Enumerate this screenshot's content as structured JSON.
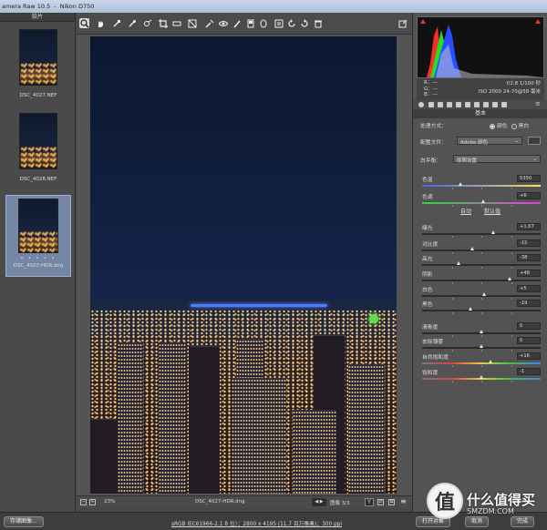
{
  "titlebar": {
    "app": "amera Raw 10.5",
    "camera": "Nikon D750"
  },
  "filmstrip": {
    "header": "胶片",
    "items": [
      {
        "name": "DSC_4027.NEF"
      },
      {
        "name": "DSC_4028.NEF"
      },
      {
        "name": "DSC_4027-HDR.dng",
        "rating": "• • • • •"
      }
    ]
  },
  "toolbar": {
    "icons": [
      "zoom-icon",
      "hand-icon",
      "white-balance-icon",
      "color-sampler-icon",
      "target-adjust-icon",
      "crop-icon",
      "straighten-icon",
      "transform-icon",
      "spot-removal-icon",
      "red-eye-icon",
      "adjustment-brush-icon",
      "graduated-filter-icon",
      "radial-filter-icon",
      "preferences-icon",
      "rotate-ccw-icon",
      "rotate-cw-icon",
      "trash-icon",
      "export-icon"
    ]
  },
  "status": {
    "zoom": "23%",
    "filename": "DSC_4027-HDR.dng",
    "image_count": "图像 3/3",
    "y_label": "Y"
  },
  "histogram": {
    "readout": {
      "r": "R：---",
      "g": "G：---",
      "b": "B：---"
    },
    "camera": {
      "line1": "f/2.8   1/100 秒",
      "line2": "ISO 2000   24-70@58 毫米"
    }
  },
  "panel": {
    "title": "基本",
    "treatment_label": "处理方式：",
    "treatment_color": "颜色",
    "treatment_bw": "黑白",
    "profile_label": "配置文件：",
    "profile_value": "Adobe 颜色",
    "wb_label": "白平衡：",
    "wb_value": "原照设置",
    "auto": "自动",
    "default": "默认值",
    "sliders": [
      {
        "label": "色温",
        "value": "5350",
        "pos": 0.33
      },
      {
        "label": "色调",
        "value": "+6",
        "pos": 0.52
      },
      {
        "label": "曝光",
        "value": "+1.67",
        "pos": 0.6
      },
      {
        "label": "对比度",
        "value": "-15",
        "pos": 0.43
      },
      {
        "label": "高光",
        "value": "-38",
        "pos": 0.31
      },
      {
        "label": "阴影",
        "value": "+48",
        "pos": 0.74
      },
      {
        "label": "白色",
        "value": "+5",
        "pos": 0.53
      },
      {
        "label": "黑色",
        "value": "-19",
        "pos": 0.41
      },
      {
        "label": "清晰度",
        "value": "0",
        "pos": 0.5
      },
      {
        "label": "去除薄雾",
        "value": "0",
        "pos": 0.5
      },
      {
        "label": "自然饱和度",
        "value": "+16",
        "pos": 0.58
      },
      {
        "label": "饱和度",
        "value": "-1",
        "pos": 0.5
      }
    ]
  },
  "bottom": {
    "save_label": "存储图像...",
    "workflow_link": "sRGB IEC61966-2.1 8 位）；2800 x 4195 (11.7 百万像素)；300 ppi",
    "open_label": "打开对象",
    "cancel_label": "取消",
    "done_label": "完成"
  },
  "watermark": {
    "badge": "值",
    "text": "什么值得买",
    "sub": "SMZDM.COM"
  },
  "colors": {
    "accent": "#7687a6",
    "bridge": "#4a7cff",
    "histogram_red": "#ff2a2a",
    "histogram_green": "#22e022",
    "histogram_blue": "#2a4cff"
  }
}
